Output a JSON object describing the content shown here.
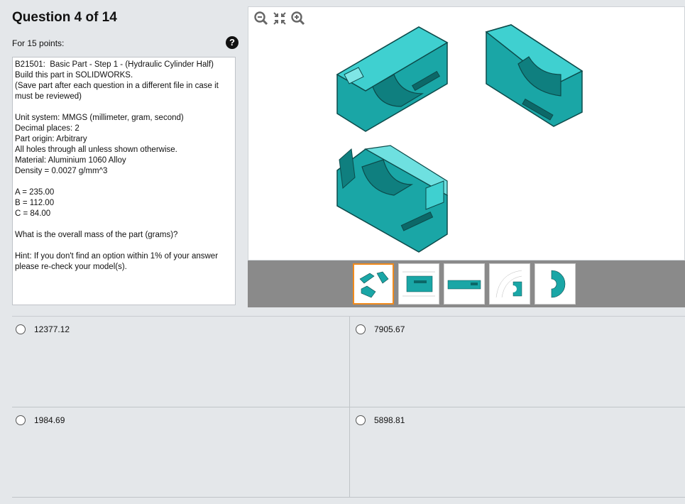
{
  "question": {
    "title": "Question 4 of 14",
    "points": "For 15 points:",
    "help_icon": "question-mark-icon"
  },
  "description": {
    "lines": [
      "B21501:  Basic Part - Step 1 - (Hydraulic Cylinder Half)",
      "Build this part in SOLIDWORKS.",
      "(Save part after each question in a different file in case it must be reviewed)",
      "",
      "Unit system: MMGS (millimeter, gram, second)",
      "Decimal places: 2",
      "Part origin: Arbitrary",
      "All holes through all unless shown otherwise.",
      "Material: Aluminium 1060 Alloy",
      "Density = 0.0027 g/mm^3",
      "",
      "A = 235.00",
      "B = 112.00",
      "C = 84.00",
      "",
      "What is the overall mass of the part (grams)?",
      "",
      "Hint: If you don't find an option within 1% of your answer please re-check your model(s)."
    ]
  },
  "viewer": {
    "tools": [
      "zoom-out-icon",
      "fit-to-screen-icon",
      "zoom-in-icon"
    ],
    "part_color": "#1aa6a6",
    "thumbnails": [
      "isometric-views",
      "front-drawing",
      "side-drawing",
      "detail-drawing",
      "end-view"
    ]
  },
  "answers": [
    {
      "value": "12377.12"
    },
    {
      "value": "7905.67"
    },
    {
      "value": "1984.69"
    },
    {
      "value": "5898.81"
    }
  ]
}
